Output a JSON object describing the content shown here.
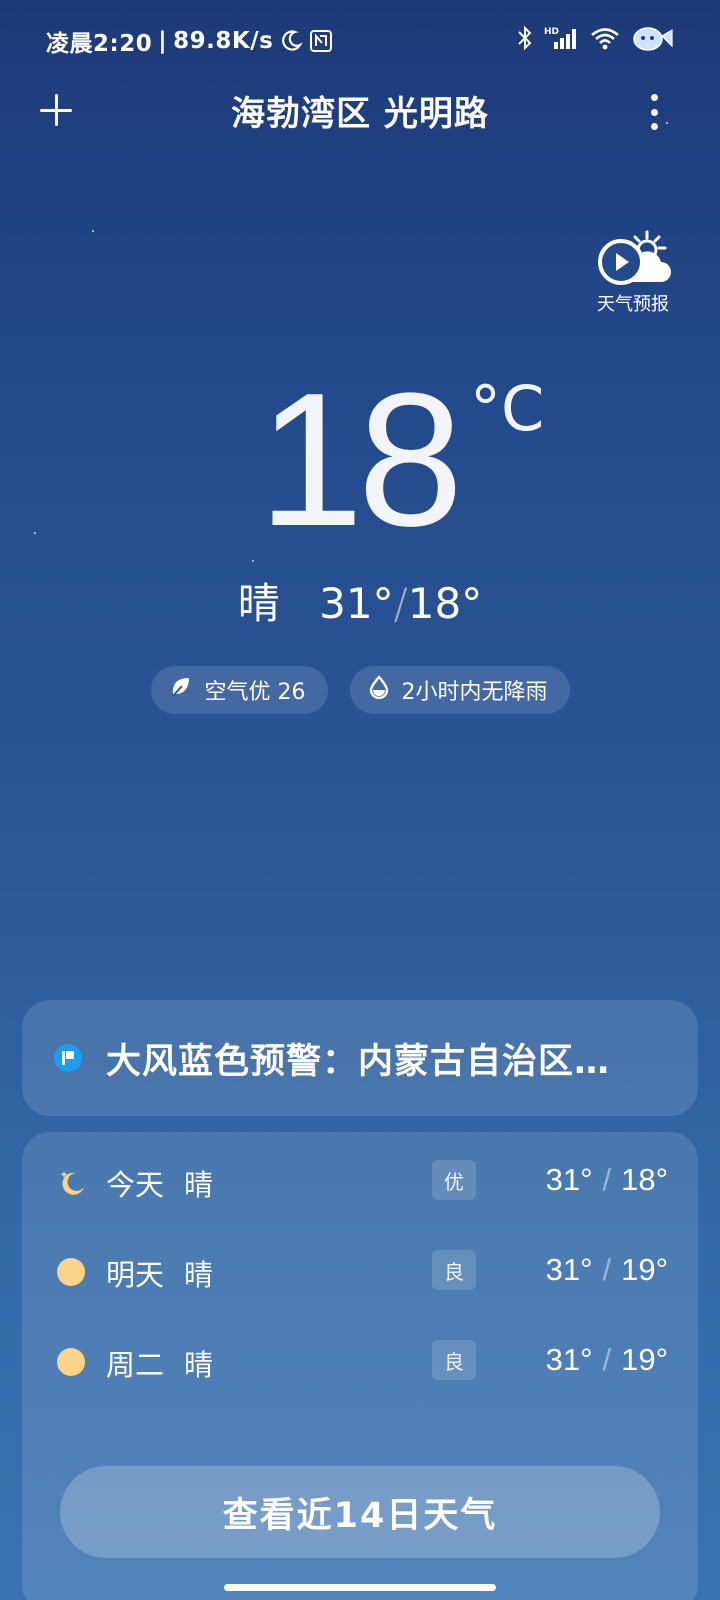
{
  "status_bar": {
    "time": "凌晨2:20",
    "separator": "|",
    "net_speed": "89.8K/s",
    "icons": [
      "moon-icon",
      "nfc-icon",
      "bluetooth-icon",
      "hd-signal-icon",
      "wifi-icon",
      "battery-icon"
    ]
  },
  "header": {
    "location": "海勃湾区 光明路",
    "add_icon": "plus-icon",
    "more_icon": "more-vertical-icon"
  },
  "forecast_video": {
    "label": "天气预报",
    "icon": "weather-video-icon"
  },
  "current": {
    "temperature": "18",
    "unit": "°C",
    "condition": "晴",
    "high": "31°",
    "slash": "/",
    "low": "18°"
  },
  "pills": {
    "air_quality": "空气优 26",
    "rain": "2小时内无降雨"
  },
  "alert": {
    "text": "大风蓝色预警：内蒙古自治区…"
  },
  "daily": [
    {
      "day": "今天",
      "condition": "晴",
      "aqi": "优",
      "high": "31°",
      "low": "18°",
      "icon": "crescent-moon-icon"
    },
    {
      "day": "明天",
      "condition": "晴",
      "aqi": "良",
      "high": "31°",
      "low": "19°",
      "icon": "sun-icon"
    },
    {
      "day": "周二",
      "condition": "晴",
      "aqi": "良",
      "high": "31°",
      "low": "19°",
      "icon": "sun-icon"
    }
  ],
  "view_14_days": "查看近14日天气",
  "colors": {
    "background_top": "#1d3a78",
    "background_bottom": "#3a73b2",
    "alert_icon": "#1a9ff0",
    "sun": "#fbd48a"
  }
}
